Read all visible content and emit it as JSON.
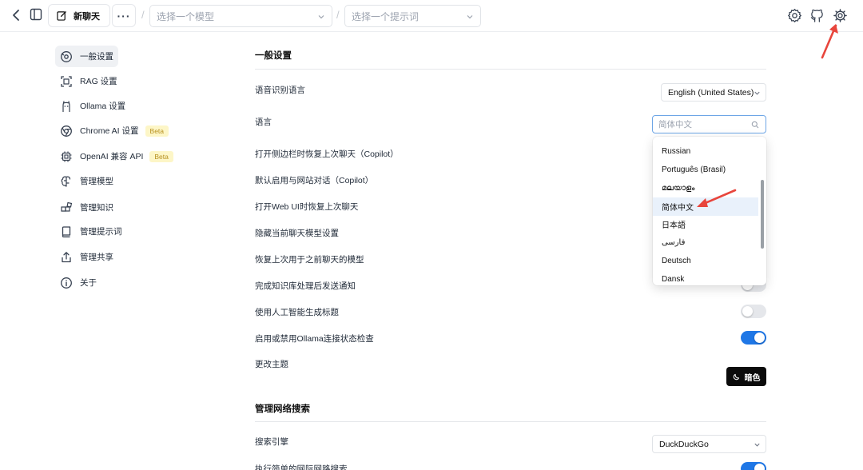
{
  "topbar": {
    "new_chat_label": "新聊天",
    "more_label": "···",
    "separator": "/",
    "model_placeholder": "选择一个模型",
    "prompt_placeholder": "选择一个提示词"
  },
  "sidebar": {
    "items": [
      {
        "label": "一般设置",
        "icon": "general-settings-icon"
      },
      {
        "label": "RAG 设置",
        "icon": "rag-icon"
      },
      {
        "label": "Ollama 设置",
        "icon": "ollama-icon"
      },
      {
        "label": "Chrome AI 设置",
        "icon": "chrome-icon",
        "badge": "Beta"
      },
      {
        "label": "OpenAI 兼容 API",
        "icon": "cpu-icon",
        "badge": "Beta"
      },
      {
        "label": "管理模型",
        "icon": "brain-icon"
      },
      {
        "label": "管理知识",
        "icon": "blocks-icon"
      },
      {
        "label": "管理提示词",
        "icon": "book-icon"
      },
      {
        "label": "管理共享",
        "icon": "share-icon"
      },
      {
        "label": "关于",
        "icon": "info-icon"
      }
    ]
  },
  "general": {
    "title": "一般设置",
    "speech_language_label": "语音识别语言",
    "speech_language_value": "English (United States)",
    "language_label": "语言",
    "language_search_value": "简体中文",
    "rows": [
      "打开侧边栏时恢复上次聊天（Copilot）",
      "默认启用与网站对话（Copilot）",
      "打开Web UI时恢复上次聊天",
      "隐藏当前聊天模型设置",
      "恢复上次用于之前聊天的模型",
      "完成知识库处理后发送通知",
      "使用人工智能生成标题",
      "启用或禁用Ollama连接状态检查"
    ],
    "toggle_states": {
      "generate_titles": false,
      "ollama_check": true
    },
    "theme_label": "更改主题",
    "theme_button": "暗色"
  },
  "web_search": {
    "title": "管理网络搜索",
    "engine_label": "搜索引擎",
    "engine_value": "DuckDuckGo",
    "simple_search_label": "执行简单的网际网路搜索"
  },
  "language_options": [
    "Russian",
    "Português (Brasil)",
    "മലയാളം",
    "简体中文",
    "日本語",
    "فارسی",
    "Deutsch",
    "Dansk"
  ],
  "colors": {
    "accent": "#1f77e6",
    "annotation": "#e8453c"
  }
}
